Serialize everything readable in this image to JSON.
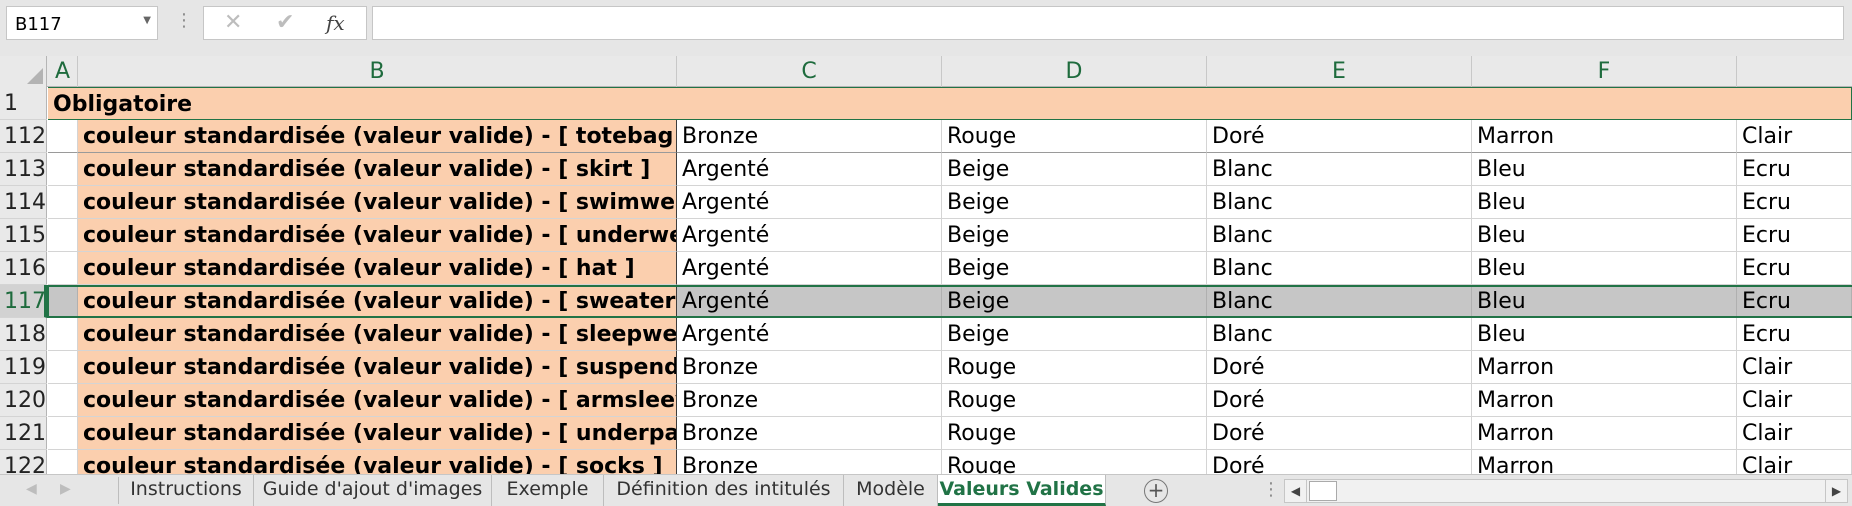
{
  "formula_bar": {
    "name_box": "B117",
    "cancel_symbol": "✕",
    "enter_symbol": "✔",
    "fx_symbol": "fx",
    "formula_value": ""
  },
  "columns": [
    "A",
    "B",
    "C",
    "D",
    "E",
    "F"
  ],
  "title_row": {
    "row_number": "1",
    "text": "Obligatoire"
  },
  "rows": [
    {
      "num": "112",
      "b": "couleur standardisée (valeur valide) - [ totebag ]",
      "c": "Bronze",
      "d": "Rouge",
      "e": "Doré",
      "f": "Marron",
      "g": "Clair"
    },
    {
      "num": "113",
      "b": "couleur standardisée (valeur valide) - [ skirt ]",
      "c": "Argenté",
      "d": "Beige",
      "e": "Blanc",
      "f": "Bleu",
      "g": "Ecru"
    },
    {
      "num": "114",
      "b": "couleur standardisée (valeur valide) - [ swimwear ]",
      "c": "Argenté",
      "d": "Beige",
      "e": "Blanc",
      "f": "Bleu",
      "g": "Ecru"
    },
    {
      "num": "115",
      "b": "couleur standardisée (valeur valide) - [ underwear ]",
      "c": "Argenté",
      "d": "Beige",
      "e": "Blanc",
      "f": "Bleu",
      "g": "Ecru"
    },
    {
      "num": "116",
      "b": "couleur standardisée (valeur valide) - [ hat ]",
      "c": "Argenté",
      "d": "Beige",
      "e": "Blanc",
      "f": "Bleu",
      "g": "Ecru"
    },
    {
      "num": "117",
      "b": "couleur standardisée (valeur valide) - [ sweater ]",
      "c": "Argenté",
      "d": "Beige",
      "e": "Blanc",
      "f": "Bleu",
      "g": "Ecru"
    },
    {
      "num": "118",
      "b": "couleur standardisée (valeur valide) - [ sleepwear ]",
      "c": "Argenté",
      "d": "Beige",
      "e": "Blanc",
      "f": "Bleu",
      "g": "Ecru"
    },
    {
      "num": "119",
      "b": "couleur standardisée (valeur valide) - [ suspender ]",
      "c": "Bronze",
      "d": "Rouge",
      "e": "Doré",
      "f": "Marron",
      "g": "Clair"
    },
    {
      "num": "120",
      "b": "couleur standardisée (valeur valide) - [ armsleeve ]",
      "c": "Bronze",
      "d": "Rouge",
      "e": "Doré",
      "f": "Marron",
      "g": "Clair"
    },
    {
      "num": "121",
      "b": "couleur standardisée (valeur valide) - [ underpants ]",
      "c": "Bronze",
      "d": "Rouge",
      "e": "Doré",
      "f": "Marron",
      "g": "Clair"
    },
    {
      "num": "122",
      "b": "couleur standardisée (valeur valide) - [ socks ]",
      "c": "Bronze",
      "d": "Rouge",
      "e": "Doré",
      "f": "Marron",
      "g": "Clair"
    }
  ],
  "selected_row": "117",
  "tabs": [
    {
      "label": "Instructions"
    },
    {
      "label": "Guide d'ajout d'images"
    },
    {
      "label": "Exemple"
    },
    {
      "label": "Définition des intitulés"
    },
    {
      "label": "Modèle"
    },
    {
      "label": "Valeurs Valides",
      "active": true
    }
  ],
  "tab_bar": {
    "add_symbol": "+",
    "scroll_left": "◀",
    "scroll_right": "▶"
  },
  "colors": {
    "accent": "#217346",
    "header_fill": "#fbcfae",
    "selection_fill": "#c6c6c6"
  }
}
